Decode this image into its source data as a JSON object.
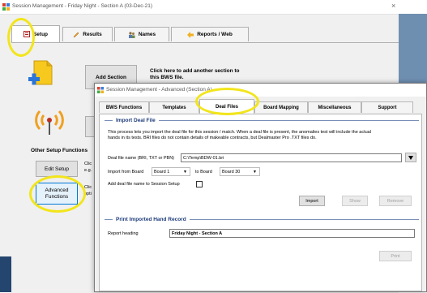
{
  "main_window": {
    "title": "Session Management - Friday Night - Section A (03-Dec-21)",
    "close_glyph": "×",
    "tabs": [
      {
        "label": "Setup",
        "icon": "setup-icon"
      },
      {
        "label": "Results",
        "icon": "pencil-icon"
      },
      {
        "label": "Names",
        "icon": "people-icon"
      },
      {
        "label": "Reports / Web",
        "icon": "reports-icon"
      }
    ],
    "add_section_button": "Add Section",
    "add_section_desc": "Click here to add another section to this BWS file.",
    "other_setup_label": "Other Setup Functions",
    "edit_setup_button": "Edit Setup",
    "edit_setup_desc_1": "Clic",
    "edit_setup_desc_2": "e.g.",
    "advanced_button_1": "Advanced",
    "advanced_button_2": "Functions",
    "advanced_desc_1": "Clic",
    "advanced_desc_2": "opti"
  },
  "dialog": {
    "title": "Session Management - Advanced (Section A)",
    "tabs": [
      "BWS Functions",
      "Templates",
      "Deal Files",
      "Board Mapping",
      "Miscellaneous",
      "Support"
    ],
    "active_tab": "Deal Files",
    "import_section_title": "Import Deal File",
    "import_desc_1": "This process lets you import the deal file for this session / match. When a deal file is present, the anomalies test will include the actual",
    "import_desc_2": "hands in its tests. BRI files do not contain details of makeable contracts, but Dealmaster Pro .TXT files do.",
    "deal_file_label": "Deal file name (BRI, TXT or PBN)",
    "deal_file_value": "C:\\Temp\\BDW-01.bri",
    "import_from_label": "Import from Board",
    "from_board": "Board 1",
    "to_label": "to Board",
    "to_board": "Board 30",
    "add_deal_label": "Add deal file name to Session Setup",
    "import_button": "Import",
    "show_button": "Show",
    "remove_button": "Remove",
    "print_section_title": "Print Imported Hand Record",
    "report_heading_label": "Report heading",
    "report_heading_value": "Friday Night - Section A",
    "print_button": "Print"
  },
  "colors": {
    "highlight": "#f2e51c",
    "right_panel": "#6f8fb1",
    "section_title": "#1d3c7a"
  }
}
